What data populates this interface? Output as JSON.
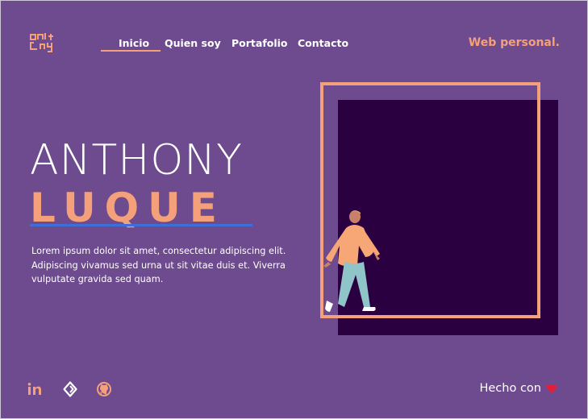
{
  "nav": {
    "items": [
      {
        "label": "Inicio",
        "active": true
      },
      {
        "label": "Quien soy"
      },
      {
        "label": "Portafolio"
      },
      {
        "label": "Contacto"
      }
    ],
    "brand": "Web personal."
  },
  "hero": {
    "first_name": "ANTHONY",
    "last_name": "LUQUE",
    "description": "Lorem ipsum dolor sit amet, consectetur adipiscing elit. Adipiscing vivamus sed urna ut sit vitae duis et. Viverra vulputate gravida sed quam."
  },
  "footer": {
    "social_icons": [
      "linkedin-icon",
      "codepen-icon",
      "github-icon"
    ],
    "made_with": "Hecho con"
  },
  "colors": {
    "background": "#6e4a8e",
    "accent": "#f4a07a",
    "dark_square": "#2a0040",
    "underline": "#3c6fd8"
  }
}
